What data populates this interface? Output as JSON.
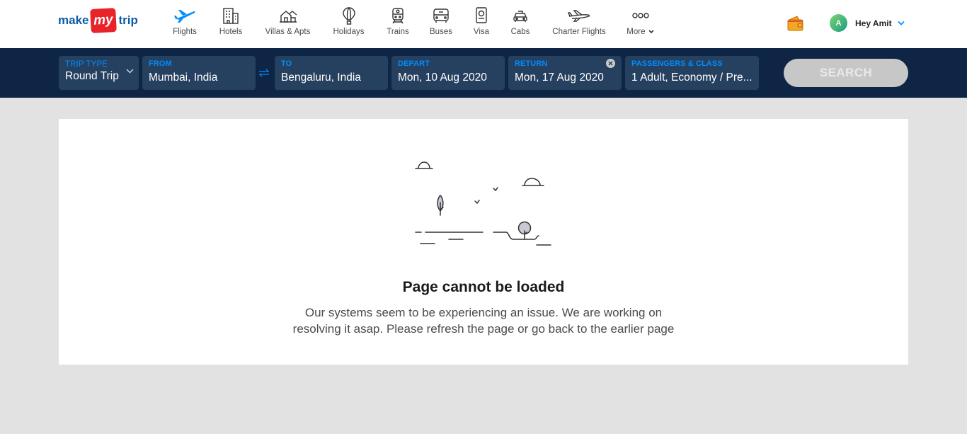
{
  "header": {
    "logo": {
      "part1": "make",
      "part2": "my",
      "part3": "trip"
    },
    "nav": [
      {
        "label": "Flights",
        "icon": "flight-icon"
      },
      {
        "label": "Hotels",
        "icon": "hotel-icon"
      },
      {
        "label": "Villas & Apts",
        "icon": "villa-icon"
      },
      {
        "label": "Holidays",
        "icon": "hot-air-balloon-icon"
      },
      {
        "label": "Trains",
        "icon": "train-icon"
      },
      {
        "label": "Buses",
        "icon": "bus-icon"
      },
      {
        "label": "Visa",
        "icon": "passport-icon"
      },
      {
        "label": "Cabs",
        "icon": "cab-icon"
      },
      {
        "label": "Charter Flights",
        "icon": "charter-plane-icon"
      },
      {
        "label": "More",
        "icon": "more-dots-icon"
      }
    ],
    "user": {
      "avatar_initial": "A",
      "greeting": "Hey Amit"
    }
  },
  "search": {
    "trip_type": {
      "label": "TRIP TYPE",
      "value": "Round Trip"
    },
    "from": {
      "label": "FROM",
      "value": "Mumbai, India"
    },
    "to": {
      "label": "TO",
      "value": "Bengaluru, India"
    },
    "depart": {
      "label": "DEPART",
      "value": "Mon, 10 Aug 2020"
    },
    "return": {
      "label": "RETURN",
      "value": "Mon, 17 Aug 2020"
    },
    "passengers": {
      "label": "PASSENGERS & CLASS",
      "value": "1 Adult, Economy / Pre..."
    },
    "button_label": "SEARCH"
  },
  "error": {
    "title": "Page cannot be loaded",
    "message_line1": "Our systems seem to be experiencing an issue. We are working on",
    "message_line2": "resolving it asap. Please refresh the page or go back to the earlier page"
  },
  "colors": {
    "brand_blue": "#008cff",
    "brand_red": "#e8232a",
    "navy_bar": "#0e2545",
    "field_bg": "#26405f",
    "search_disabled": "#c7c7c7",
    "page_bg": "#e2e2e2"
  }
}
